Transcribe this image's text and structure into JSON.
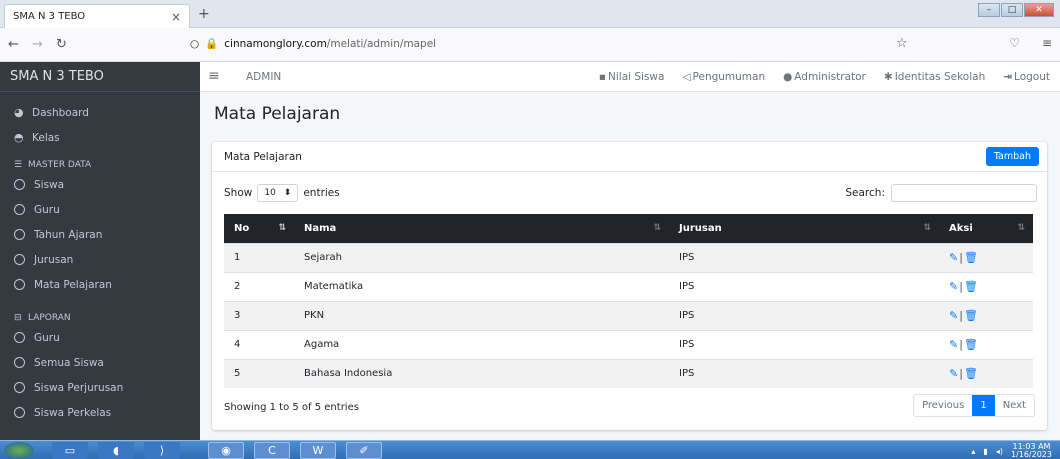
{
  "browser": {
    "tab_title": "SMA N 3 TEBO",
    "tab_close": "×",
    "new_tab": "+",
    "url_host": "cinnamonglory.com",
    "url_path": "/melati/admin/mapel"
  },
  "sidebar": {
    "brand": "SMA N 3 TEBO",
    "items_top": [
      {
        "label": "Dashboard",
        "icon": "dashboard-icon"
      },
      {
        "label": "Kelas",
        "icon": "kelas-icon"
      }
    ],
    "master_header": "MASTER DATA",
    "master_items": [
      "Siswa",
      "Guru",
      "Tahun Ajaran",
      "Jurusan",
      "Mata Pelajaran"
    ],
    "laporan_header": "LAPORAN",
    "laporan_items": [
      "Guru",
      "Semua Siswa",
      "Siswa Perjurusan",
      "Siswa Perkelas"
    ]
  },
  "navbar": {
    "admin": "ADMIN",
    "links": [
      "Nilai Siswa",
      "Pengumuman",
      "Administrator",
      "Identitas Sekolah",
      "Logout"
    ]
  },
  "page": {
    "title": "Mata Pelajaran",
    "card_title": "Mata Pelajaran",
    "add_button": "Tambah",
    "show_label": "Show",
    "entries_select": "10",
    "entries_label": "entries",
    "search_label": "Search:",
    "columns": [
      "No",
      "Nama",
      "Jurusan",
      "Aksi"
    ],
    "rows": [
      {
        "no": "1",
        "nama": "Sejarah",
        "jurusan": "IPS"
      },
      {
        "no": "2",
        "nama": "Matematika",
        "jurusan": "IPS"
      },
      {
        "no": "3",
        "nama": "PKN",
        "jurusan": "IPS"
      },
      {
        "no": "4",
        "nama": "Agama",
        "jurusan": "IPS"
      },
      {
        "no": "5",
        "nama": "Bahasa Indonesia",
        "jurusan": "IPS"
      }
    ],
    "info": "Showing 1 to 5 of 5 entries",
    "pager": {
      "prev": "Previous",
      "current": "1",
      "next": "Next"
    }
  },
  "taskbar": {
    "time": "11:03 AM",
    "date": "1/16/2023"
  },
  "colors": {
    "primary": "#007bff",
    "sidebar": "#343a40",
    "table_head": "#212529"
  }
}
